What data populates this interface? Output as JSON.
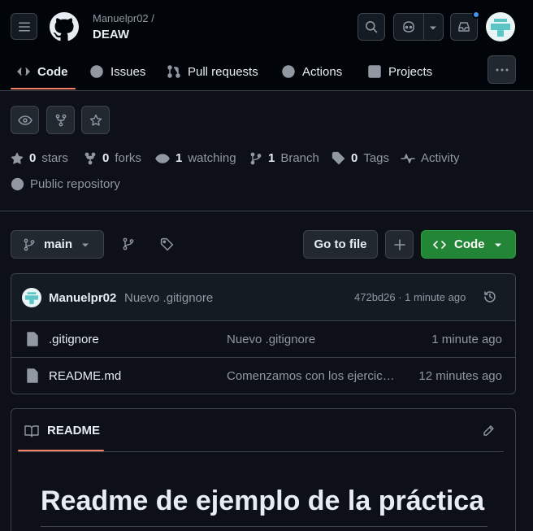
{
  "header": {
    "owner": "Manuelpr02 /",
    "repo": "DEAW"
  },
  "tabs": [
    {
      "label": "Code"
    },
    {
      "label": "Issues"
    },
    {
      "label": "Pull requests"
    },
    {
      "label": "Actions"
    },
    {
      "label": "Projects"
    }
  ],
  "stats": {
    "stars_count": "0",
    "stars_label": "stars",
    "forks_count": "0",
    "forks_label": "forks",
    "watching_count": "1",
    "watching_label": "watching",
    "branch_count": "1",
    "branch_label": "Branch",
    "tags_count": "0",
    "tags_label": "Tags",
    "activity_label": "Activity",
    "visibility": "Public repository"
  },
  "toolbar": {
    "branch": "main",
    "go_to_file": "Go to file",
    "code_button": "Code"
  },
  "commit": {
    "author": "Manuelpr02",
    "message": "Nuevo .gitignore",
    "meta": "472bd26 · 1 minute ago"
  },
  "files": [
    {
      "name": ".gitignore",
      "message": "Nuevo .gitignore",
      "time": "1 minute ago"
    },
    {
      "name": "README.md",
      "message": "Comenzamos con los ejercicios",
      "time": "12 minutes ago"
    }
  ],
  "readme": {
    "tab_label": "README",
    "heading": "Readme de ejemplo de la práctica"
  },
  "colors": {
    "accent_green": "#238636",
    "tab_underline": "#f78166",
    "notification_dot": "#4493f8"
  }
}
